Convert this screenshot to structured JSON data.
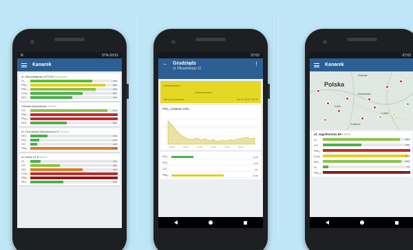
{
  "phone1": {
    "status": {
      "left": "N",
      "right": "57% 03:52"
    },
    "app_title": "Kanarek",
    "stations": [
      {
        "title": "al. Niepodległości 227/233",
        "sub": "Warszawa",
        "rows": [
          {
            "label": "O₃",
            "value": "71%",
            "level": 0.71,
            "color": "#5cbf2a"
          },
          {
            "label": "PM₁₀",
            "value": "58%",
            "level": 0.86,
            "color": "#e0cf23"
          },
          {
            "label": "PM₂.₅",
            "value": "75%",
            "level": 0.75,
            "color": "#8bc34a"
          },
          {
            "label": "C₆H₆",
            "value": "84%",
            "level": 0.6,
            "color": "#4caf50"
          },
          {
            "label": "NO₂",
            "value": "76%",
            "level": 0.48,
            "color": "#4caf50"
          }
        ]
      },
      {
        "title": "Gdańsk Wyzwolenia",
        "sub": "Gdańsk",
        "rows": [
          {
            "label": "CO",
            "value": "97%",
            "level": 0.88,
            "color": "#8bc34a"
          },
          {
            "label": "PM₁₀",
            "value": "254%",
            "level": 1.0,
            "color": "#c62828"
          },
          {
            "label": "PM₂.₅",
            "value": "257%",
            "level": 1.0,
            "color": "#c62828"
          },
          {
            "label": "NO₂",
            "value": "89%",
            "level": 0.42,
            "color": "#4caf50"
          }
        ]
      },
      {
        "title": "ul. Poznańska Mieszkańców B",
        "sub": "Poznań",
        "rows": [
          {
            "label": "NO₂",
            "value": "74%",
            "level": 0.2,
            "color": "#4caf50"
          },
          {
            "label": "SO₂",
            "value": "16%",
            "level": 0.1,
            "color": "#4caf50"
          },
          {
            "label": "CO",
            "value": "22%",
            "level": 0.08,
            "color": "#4caf50"
          },
          {
            "label": "PM₁₀",
            "value": "111%",
            "level": 1.0,
            "color": "#e07b24"
          }
        ]
      },
      {
        "title": "ul. Kielce 21 B",
        "sub": "Kielce",
        "rows": [
          {
            "label": "O₃",
            "value": "72%",
            "level": 0.12,
            "color": "#4caf50"
          },
          {
            "label": "CO",
            "value": "48%",
            "level": 0.34,
            "color": "#8bc34a"
          },
          {
            "label": "SO₂",
            "value": "54%",
            "level": 0.6,
            "color": "#e07b24"
          },
          {
            "label": "C₆H₆",
            "value": "178%",
            "level": 1.0,
            "color": "#c62828"
          },
          {
            "label": "PM₁₀",
            "value": "283%",
            "level": 1.0,
            "color": "#8e1a1a"
          },
          {
            "label": "NO₂",
            "value": "40%",
            "level": 0.38,
            "color": "#4caf50"
          }
        ]
      }
    ]
  },
  "phone2": {
    "status": {
      "left": "",
      "right": "07:02"
    },
    "app_title": "Grudziądz",
    "subtitle": "ul. Piłsudskiego 11",
    "quality": {
      "top": "Umiarkowana",
      "middle": "Umiarkowana",
      "bottom_left": "Jakość powietrza",
      "bottom_right": "28.01.2017 02:00"
    },
    "chart_title": "PM₁₀ (ostatnie 24h)",
    "rows": [
      {
        "label": "NO₂",
        "value": "24.66",
        "level": 0.25,
        "color": "#4caf50"
      },
      {
        "label": "SO₂",
        "value": "8.53",
        "level": 0.0,
        "color": "#4caf50"
      },
      {
        "label": "CO",
        "value": "612",
        "level": 0.0,
        "color": "#4caf50"
      },
      {
        "label": "PM₁₀",
        "value": "65.45",
        "level": 0.6,
        "color": "#e0cf23"
      }
    ]
  },
  "phone3": {
    "status": {
      "left": "",
      "right": "07:02"
    },
    "app_title": "Kanarek",
    "map": {
      "country": "Polska",
      "cities": [
        "Gdańsk",
        "Warszawa",
        "Łódź",
        "Kraków",
        "Lublin"
      ]
    },
    "station_title": "ul. Jagiellońska 69",
    "station_sub": "Kielce",
    "rows": [
      {
        "label": "O₃",
        "value": "89%",
        "level": 0.88,
        "color": "#8bc34a"
      },
      {
        "label": "CO",
        "value": "44%",
        "level": 0.44,
        "color": "#4caf50"
      },
      {
        "label": "PM₁₀",
        "value": "154%",
        "level": 1.0,
        "color": "#c62828"
      },
      {
        "label": "C₆H₆",
        "value": "98%",
        "level": 0.97,
        "color": "#e0cf23"
      },
      {
        "label": "NO₂",
        "value": "91%",
        "level": 0.9,
        "color": "#8bc34a"
      },
      {
        "label": "O₃",
        "value": "7%",
        "level": 0.06,
        "color": "#4caf50"
      },
      {
        "label": "PM₂.₅",
        "value": "142%",
        "level": 1.0,
        "color": "#8e1a1a"
      }
    ]
  }
}
